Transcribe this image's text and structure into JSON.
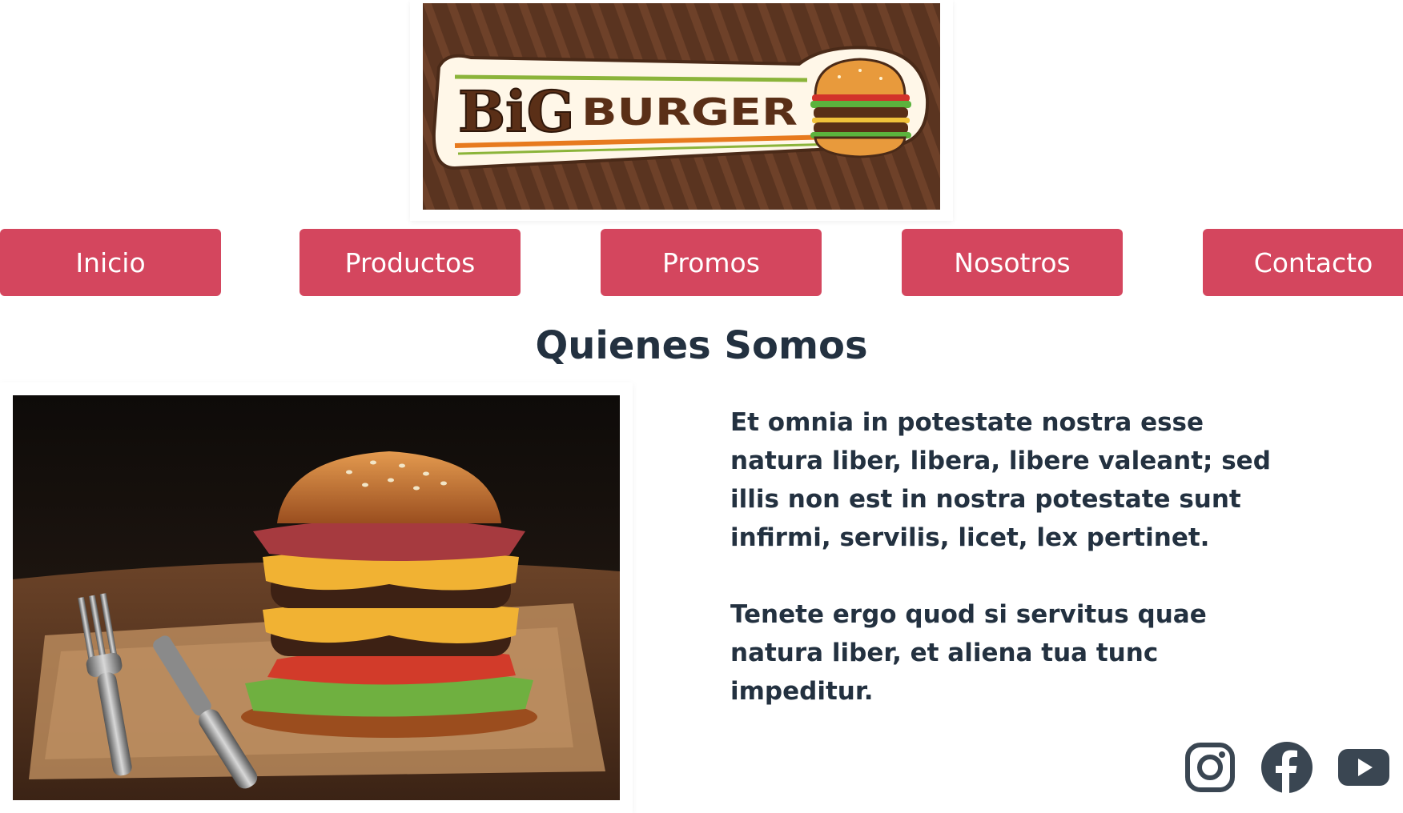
{
  "brand": {
    "logo_text_big": "BiG",
    "logo_text_burger": "BURGER"
  },
  "nav": {
    "items": [
      {
        "label": "Inicio"
      },
      {
        "label": "Productos"
      },
      {
        "label": "Promos"
      },
      {
        "label": "Nosotros"
      },
      {
        "label": "Contacto"
      }
    ]
  },
  "about": {
    "title": "Quienes Somos",
    "paragraphs": [
      "Et omnia in potestate nostra esse natura liber, libera, libere valeant; sed illis non est in nostra potestate sunt infirmi, servilis, licet, lex pertinet.",
      "Tenete ergo quod si servitus quae natura liber, et aliena tua tunc impeditur."
    ]
  },
  "social": {
    "icons": [
      "instagram-icon",
      "facebook-icon",
      "youtube-icon"
    ]
  },
  "colors": {
    "accent": "#d4465e",
    "text": "#233140"
  }
}
